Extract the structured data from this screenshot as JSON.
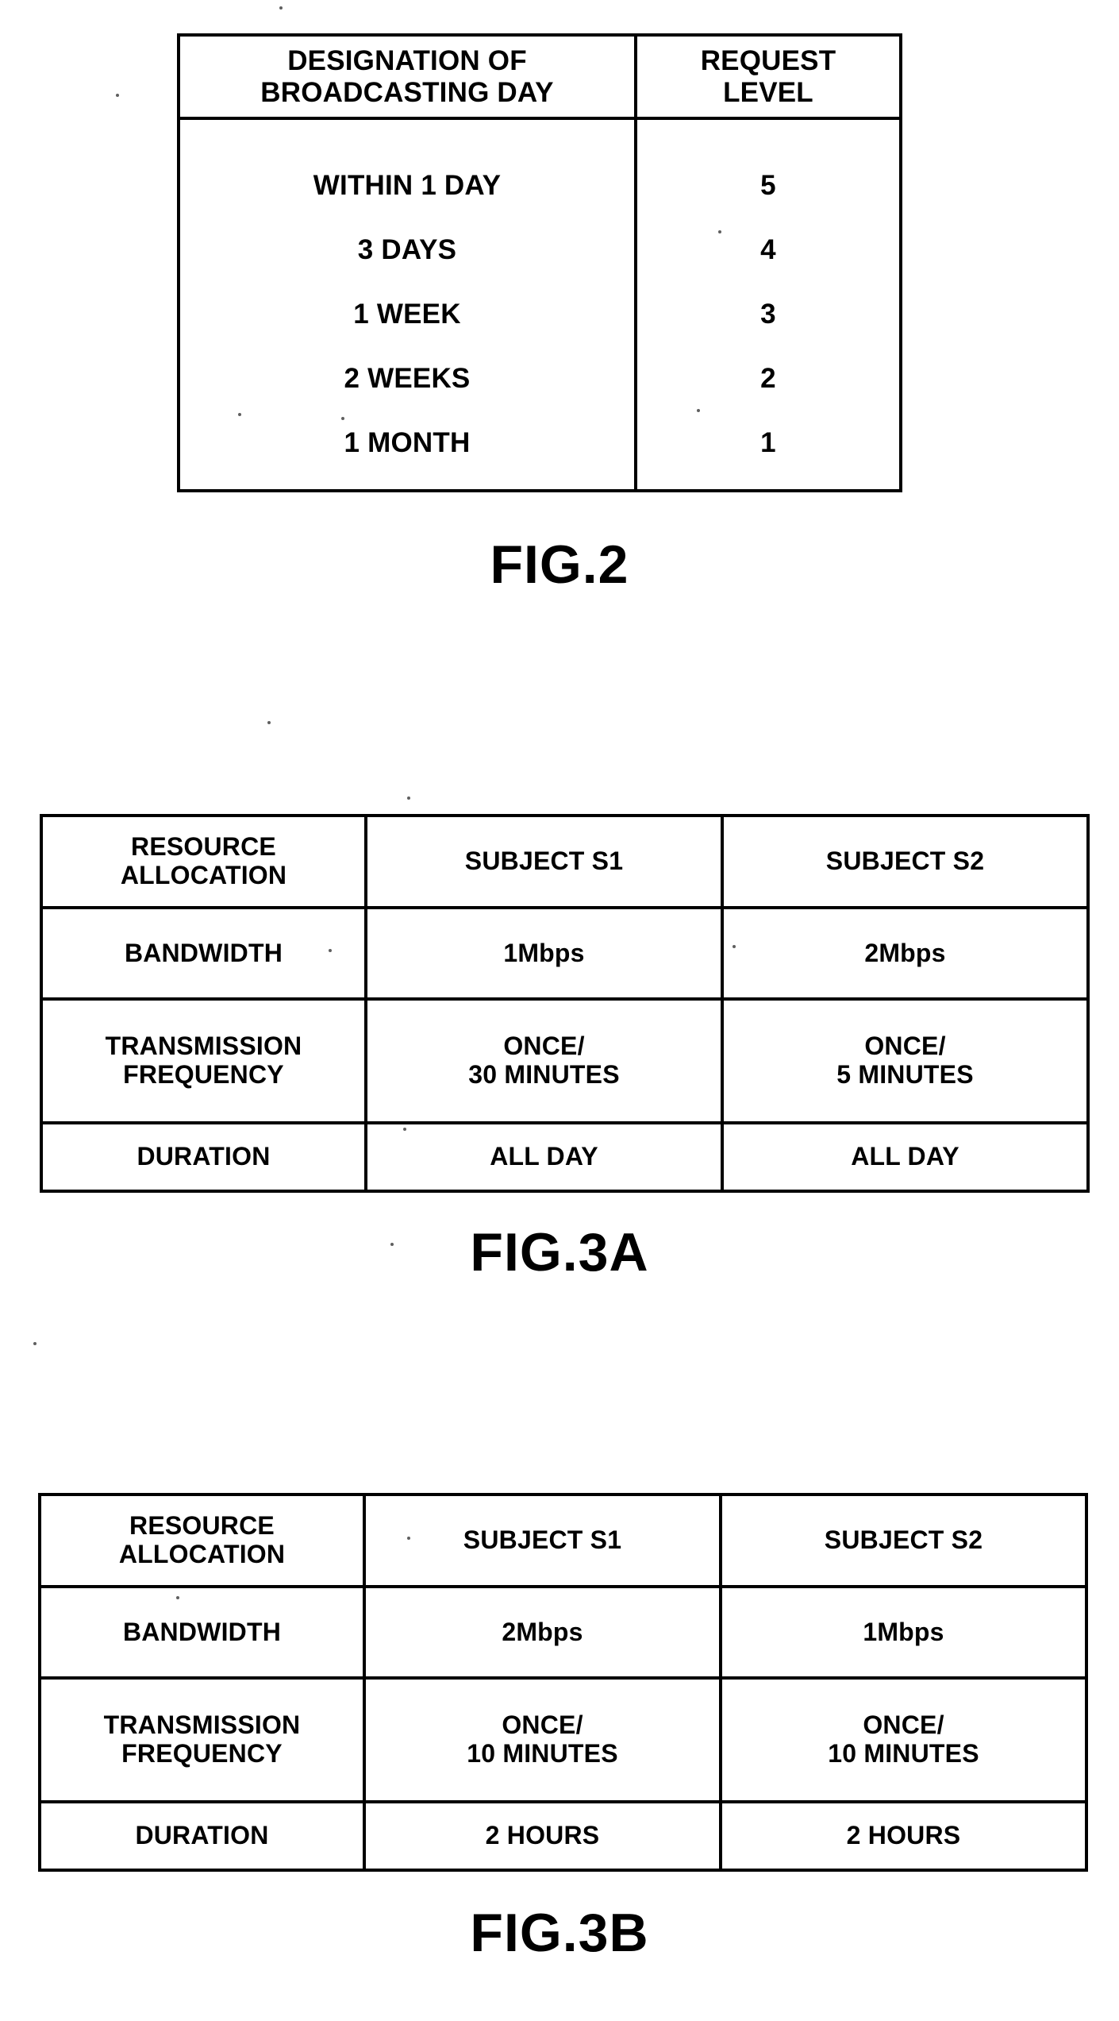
{
  "document": {
    "type": "patent-drawing-sheet",
    "background_color": "#ffffff",
    "ink_color": "#000000"
  },
  "figures": [
    {
      "id": "fig2",
      "caption": "FIG.2",
      "table": {
        "headers": [
          "DESIGNATION OF\nBROADCASTING DAY",
          "REQUEST\nLEVEL"
        ],
        "header_lines": {
          "col0_line1": "DESIGNATION OF",
          "col0_line2": "BROADCASTING DAY",
          "col1_line1": "REQUEST",
          "col1_line2": "LEVEL"
        },
        "rows": [
          {
            "designation": "WITHIN 1 DAY",
            "level": "5"
          },
          {
            "designation": "3 DAYS",
            "level": "4"
          },
          {
            "designation": "1 WEEK",
            "level": "3"
          },
          {
            "designation": "2 WEEKS",
            "level": "2"
          },
          {
            "designation": "1 MONTH",
            "level": "1"
          }
        ]
      }
    },
    {
      "id": "fig3a",
      "caption": "FIG.3A",
      "table": {
        "headers": [
          "RESOURCE\nALLOCATION",
          "SUBJECT S1",
          "SUBJECT S2"
        ],
        "header_lines": {
          "col0_line1": "RESOURCE",
          "col0_line2": "ALLOCATION",
          "col1": "SUBJECT S1",
          "col2": "SUBJECT S2"
        },
        "rows": [
          {
            "label": "BANDWIDTH",
            "s1": "1Mbps",
            "s2": "2Mbps"
          },
          {
            "label": "TRANSMISSION\nFREQUENCY",
            "s1": "ONCE/\n30 MINUTES",
            "s2": "ONCE/\n5 MINUTES"
          },
          {
            "label": "DURATION",
            "s1": "ALL DAY",
            "s2": "ALL DAY"
          }
        ]
      }
    },
    {
      "id": "fig3b",
      "caption": "FIG.3B",
      "table": {
        "headers": [
          "RESOURCE\nALLOCATION",
          "SUBJECT S1",
          "SUBJECT S2"
        ],
        "header_lines": {
          "col0_line1": "RESOURCE",
          "col0_line2": "ALLOCATION",
          "col1": "SUBJECT S1",
          "col2": "SUBJECT S2"
        },
        "rows": [
          {
            "label": "BANDWIDTH",
            "s1": "2Mbps",
            "s2": "1Mbps"
          },
          {
            "label": "TRANSMISSION\nFREQUENCY",
            "s1": "ONCE/\n10 MINUTES",
            "s2": "ONCE/\n10 MINUTES"
          },
          {
            "label": "DURATION",
            "s1": "2 HOURS",
            "s2": "2 HOURS"
          }
        ]
      }
    }
  ]
}
